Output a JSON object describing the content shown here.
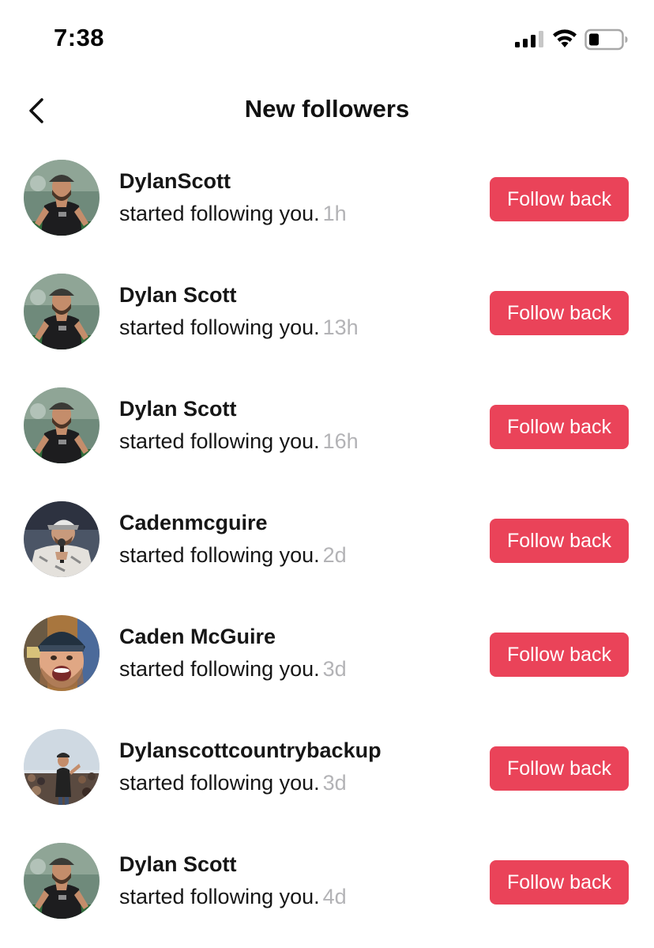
{
  "status_bar": {
    "time": "7:38",
    "signal_icon": "cellular-signal-icon",
    "wifi_icon": "wifi-icon",
    "battery_icon": "battery-low-icon"
  },
  "header": {
    "back_icon": "chevron-left-icon",
    "title": "New followers"
  },
  "colors": {
    "accent": "#ea4359",
    "timestamp": "#b3b3b6",
    "text": "#161616"
  },
  "followers": [
    {
      "username": "DylanScott",
      "activity": "started following you.",
      "time": "1h",
      "button_label": "Follow back",
      "avatar": "dylan"
    },
    {
      "username": "Dylan Scott",
      "activity": "started following you.",
      "time": "13h",
      "button_label": "Follow back",
      "avatar": "dylan"
    },
    {
      "username": "Dylan Scott",
      "activity": "started following you.",
      "time": "16h",
      "button_label": "Follow back",
      "avatar": "dylan"
    },
    {
      "username": "Cadenmcguire",
      "activity": "started following you.",
      "time": "2d",
      "button_label": "Follow back",
      "avatar": "caden-stage"
    },
    {
      "username": "Caden McGuire",
      "activity": "started following you.",
      "time": "3d",
      "button_label": "Follow back",
      "avatar": "caden-selfie"
    },
    {
      "username": "Dylanscottcountrybackup",
      "activity": "started following you.",
      "time": "3d",
      "button_label": "Follow back",
      "avatar": "dylan-crowd"
    },
    {
      "username": "Dylan Scott",
      "activity": "started following you.",
      "time": "4d",
      "button_label": "Follow back",
      "avatar": "dylan"
    }
  ]
}
